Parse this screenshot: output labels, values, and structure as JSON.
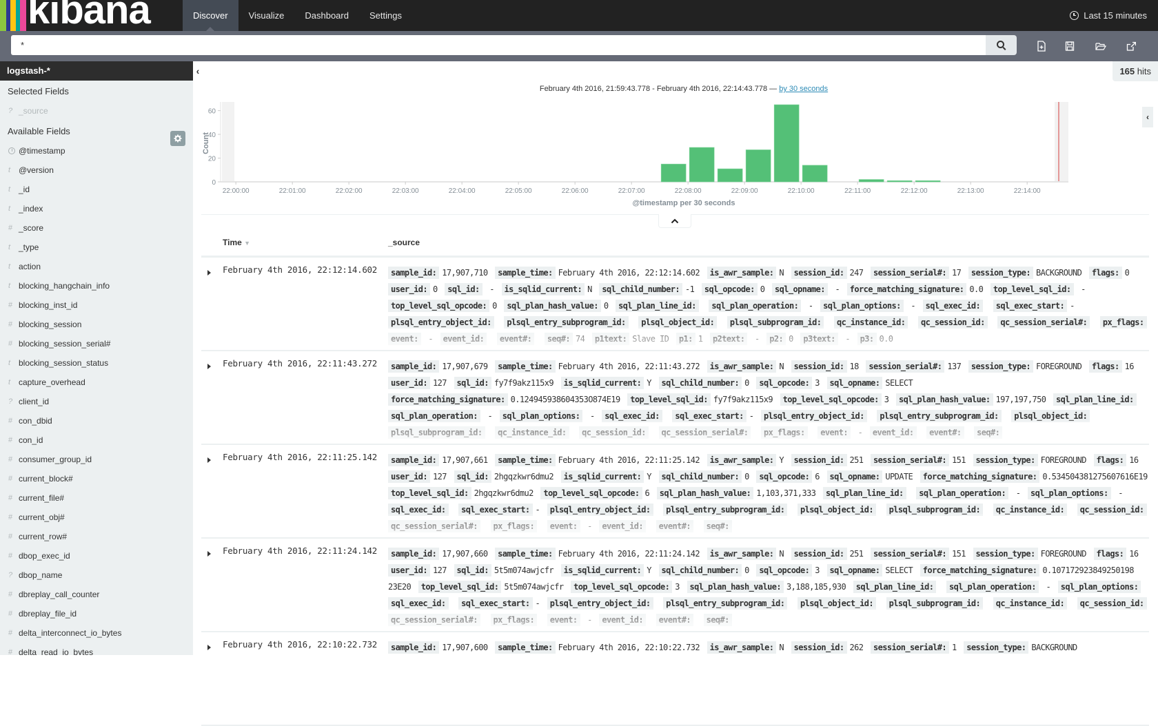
{
  "nav": {
    "brand": "kibana",
    "brand_stripes": [
      "#8cc63f",
      "#2d3991",
      "#fec514",
      "#00a69b",
      "#ec4899"
    ],
    "items": [
      {
        "label": "Discover",
        "active": true
      },
      {
        "label": "Visualize",
        "active": false
      },
      {
        "label": "Dashboard",
        "active": false
      },
      {
        "label": "Settings",
        "active": false
      }
    ],
    "time_range": "Last 15 minutes"
  },
  "search": {
    "query": "*",
    "icons": [
      "search-icon",
      "new-document-icon",
      "save-icon",
      "open-folder-icon",
      "share-icon"
    ]
  },
  "sidebar": {
    "index_pattern": "logstash-*",
    "selected_title": "Selected Fields",
    "selected_fields": [
      {
        "type": "?",
        "name": "_source"
      }
    ],
    "available_title": "Available Fields",
    "available_fields": [
      {
        "type": "clock",
        "name": "@timestamp"
      },
      {
        "type": "t",
        "name": "@version"
      },
      {
        "type": "t",
        "name": "_id"
      },
      {
        "type": "t",
        "name": "_index"
      },
      {
        "type": "#",
        "name": "_score"
      },
      {
        "type": "t",
        "name": "_type"
      },
      {
        "type": "t",
        "name": "action"
      },
      {
        "type": "t",
        "name": "blocking_hangchain_info"
      },
      {
        "type": "#",
        "name": "blocking_inst_id"
      },
      {
        "type": "#",
        "name": "blocking_session"
      },
      {
        "type": "#",
        "name": "blocking_session_serial#"
      },
      {
        "type": "t",
        "name": "blocking_session_status"
      },
      {
        "type": "t",
        "name": "capture_overhead"
      },
      {
        "type": "?",
        "name": "client_id"
      },
      {
        "type": "#",
        "name": "con_dbid"
      },
      {
        "type": "#",
        "name": "con_id"
      },
      {
        "type": "#",
        "name": "consumer_group_id"
      },
      {
        "type": "#",
        "name": "current_block#"
      },
      {
        "type": "#",
        "name": "current_file#"
      },
      {
        "type": "#",
        "name": "current_obj#"
      },
      {
        "type": "#",
        "name": "current_row#"
      },
      {
        "type": "#",
        "name": "dbop_exec_id"
      },
      {
        "type": "?",
        "name": "dbop_name"
      },
      {
        "type": "#",
        "name": "dbreplay_call_counter"
      },
      {
        "type": "#",
        "name": "dbreplay_file_id"
      },
      {
        "type": "#",
        "name": "delta_interconnect_io_bytes"
      },
      {
        "type": "#",
        "name": "delta_read_io_bytes"
      }
    ]
  },
  "hits": {
    "count": "165",
    "label": "hits"
  },
  "chart_caption": {
    "range": "February 4th 2016, 21:59:43.778 - February 4th 2016, 22:14:43.778 —",
    "interval_link": "by 30 seconds"
  },
  "chart_data": {
    "type": "bar",
    "title": "",
    "xlabel": "@timestamp per 30 seconds",
    "ylabel": "Count",
    "ylim": [
      0,
      65
    ],
    "yticks": [
      0,
      20,
      40,
      60
    ],
    "xticks": [
      "22:00:00",
      "22:01:00",
      "22:02:00",
      "22:03:00",
      "22:04:00",
      "22:05:00",
      "22:06:00",
      "22:07:00",
      "22:08:00",
      "22:09:00",
      "22:10:00",
      "22:11:00",
      "22:12:00",
      "22:13:00",
      "22:14:00"
    ],
    "categories": [
      "22:07:30",
      "22:08:00",
      "22:08:30",
      "22:09:00",
      "22:09:30",
      "22:10:00",
      "22:10:30",
      "22:11:00",
      "22:11:30",
      "22:12:00"
    ],
    "values": [
      15,
      29,
      11,
      27,
      65,
      14,
      0,
      2,
      1,
      1
    ],
    "bar_color": "#54c077",
    "now_marker_color": "#e07a7a",
    "grid": false
  },
  "table": {
    "columns": [
      "Time",
      "_source"
    ],
    "rows": [
      {
        "time": "February 4th 2016, 22:12:14.602",
        "fields": [
          [
            "sample_id:",
            "17,907,710"
          ],
          [
            "sample_time:",
            "February 4th 2016, 22:12:14.602"
          ],
          [
            "is_awr_sample:",
            "N"
          ],
          [
            "session_id:",
            "247"
          ],
          [
            "session_serial#:",
            "17"
          ],
          [
            "session_type:",
            "BACKGROUND"
          ],
          [
            "flags:",
            "0"
          ],
          [
            "user_id:",
            "0"
          ],
          [
            "sql_id:",
            " - "
          ],
          [
            "is_sqlid_current:",
            "N"
          ],
          [
            "sql_child_number:",
            "-1"
          ],
          [
            "sql_opcode:",
            "0"
          ],
          [
            "sql_opname:",
            " - "
          ],
          [
            "force_matching_signature:",
            "0.0"
          ],
          [
            "top_level_sql_id:",
            " - "
          ],
          [
            "top_level_sql_opcode:",
            "0"
          ],
          [
            "sql_plan_hash_value:",
            "0"
          ],
          [
            "sql_plan_line_id:",
            ""
          ],
          [
            "sql_plan_operation:",
            " - "
          ],
          [
            "sql_plan_options:",
            " - "
          ],
          [
            "sql_exec_id:",
            ""
          ],
          [
            "sql_exec_start:",
            "-"
          ],
          [
            "plsql_entry_object_id:",
            ""
          ],
          [
            "plsql_entry_subprogram_id:",
            ""
          ],
          [
            "plsql_object_id:",
            ""
          ],
          [
            "plsql_subprogram_id:",
            ""
          ],
          [
            "qc_instance_id:",
            ""
          ],
          [
            "qc_session_id:",
            ""
          ],
          [
            "qc_session_serial#:",
            ""
          ],
          [
            "px_flags:",
            ""
          ],
          [
            "event:",
            " - "
          ],
          [
            "event_id:",
            ""
          ],
          [
            "event#:",
            ""
          ],
          [
            "seq#:",
            "74"
          ],
          [
            "p1text:",
            "Slave ID"
          ],
          [
            "p1:",
            "1"
          ],
          [
            "p2text:",
            " - "
          ],
          [
            "p2:",
            "0"
          ],
          [
            "p3text:",
            " - "
          ],
          [
            "p3:",
            "0.0"
          ]
        ]
      },
      {
        "time": "February 4th 2016, 22:11:43.272",
        "fields": [
          [
            "sample_id:",
            "17,907,679"
          ],
          [
            "sample_time:",
            "February 4th 2016, 22:11:43.272"
          ],
          [
            "is_awr_sample:",
            "N"
          ],
          [
            "session_id:",
            "18"
          ],
          [
            "session_serial#:",
            "137"
          ],
          [
            "session_type:",
            "FOREGROUND"
          ],
          [
            "flags:",
            "16"
          ],
          [
            "user_id:",
            "127"
          ],
          [
            "sql_id:",
            "fy7f9akz115x9"
          ],
          [
            "is_sqlid_current:",
            "Y"
          ],
          [
            "sql_child_number:",
            "0"
          ],
          [
            "sql_opcode:",
            "3"
          ],
          [
            "sql_opname:",
            "SELECT"
          ],
          [
            "force_matching_signature:",
            "0.124945938604353O874E19"
          ],
          [
            "top_level_sql_id:",
            "fy7f9akz115x9"
          ],
          [
            "top_level_sql_opcode:",
            "3"
          ],
          [
            "sql_plan_hash_value:",
            "197,197,750"
          ],
          [
            "sql_plan_line_id:",
            ""
          ],
          [
            "sql_plan_operation:",
            " - "
          ],
          [
            "sql_plan_options:",
            " - "
          ],
          [
            "sql_exec_id:",
            ""
          ],
          [
            "sql_exec_start:",
            "-"
          ],
          [
            "plsql_entry_object_id:",
            ""
          ],
          [
            "plsql_entry_subprogram_id:",
            ""
          ],
          [
            "plsql_object_id:",
            ""
          ],
          [
            "plsql_subprogram_id:",
            ""
          ],
          [
            "qc_instance_id:",
            ""
          ],
          [
            "qc_session_id:",
            ""
          ],
          [
            "qc_session_serial#:",
            ""
          ],
          [
            "px_flags:",
            ""
          ],
          [
            "event:",
            " - "
          ],
          [
            "event_id:",
            ""
          ],
          [
            "event#:",
            ""
          ],
          [
            "seq#:",
            ""
          ]
        ]
      },
      {
        "time": "February 4th 2016, 22:11:25.142",
        "fields": [
          [
            "sample_id:",
            "17,907,661"
          ],
          [
            "sample_time:",
            "February 4th 2016, 22:11:25.142"
          ],
          [
            "is_awr_sample:",
            "Y"
          ],
          [
            "session_id:",
            "251"
          ],
          [
            "session_serial#:",
            "151"
          ],
          [
            "session_type:",
            "FOREGROUND"
          ],
          [
            "flags:",
            "16"
          ],
          [
            "user_id:",
            "127"
          ],
          [
            "sql_id:",
            "2hgqzkwr6dmu2"
          ],
          [
            "is_sqlid_current:",
            "Y"
          ],
          [
            "sql_child_number:",
            "0"
          ],
          [
            "sql_opcode:",
            "6"
          ],
          [
            "sql_opname:",
            "UPDATE"
          ],
          [
            "force_matching_signature:",
            "0.534504381275607616E19"
          ],
          [
            "top_level_sql_id:",
            "2hgqzkwr6dmu2"
          ],
          [
            "top_level_sql_opcode:",
            "6"
          ],
          [
            "sql_plan_hash_value:",
            "1,103,371,333"
          ],
          [
            "sql_plan_line_id:",
            ""
          ],
          [
            "sql_plan_operation:",
            " - "
          ],
          [
            "sql_plan_options:",
            " - "
          ],
          [
            "sql_exec_id:",
            ""
          ],
          [
            "sql_exec_start:",
            "-"
          ],
          [
            "plsql_entry_object_id:",
            ""
          ],
          [
            "plsql_entry_subprogram_id:",
            ""
          ],
          [
            "plsql_object_id:",
            ""
          ],
          [
            "plsql_subprogram_id:",
            ""
          ],
          [
            "qc_instance_id:",
            ""
          ],
          [
            "qc_session_id:",
            ""
          ],
          [
            "qc_session_serial#:",
            ""
          ],
          [
            "px_flags:",
            ""
          ],
          [
            "event:",
            " - "
          ],
          [
            "event_id:",
            ""
          ],
          [
            "event#:",
            ""
          ],
          [
            "seq#:",
            ""
          ]
        ]
      },
      {
        "time": "February 4th 2016, 22:11:24.142",
        "fields": [
          [
            "sample_id:",
            "17,907,660"
          ],
          [
            "sample_time:",
            "February 4th 2016, 22:11:24.142"
          ],
          [
            "is_awr_sample:",
            "N"
          ],
          [
            "session_id:",
            "251"
          ],
          [
            "session_serial#:",
            "151"
          ],
          [
            "session_type:",
            "FOREGROUND"
          ],
          [
            "flags:",
            "16"
          ],
          [
            "user_id:",
            "127"
          ],
          [
            "sql_id:",
            "5t5m074awjcfr"
          ],
          [
            "is_sqlid_current:",
            "Y"
          ],
          [
            "sql_child_number:",
            "0"
          ],
          [
            "sql_opcode:",
            "3"
          ],
          [
            "sql_opname:",
            "SELECT"
          ],
          [
            "force_matching_signature:",
            "0.107172923849250198 23E20"
          ],
          [
            "top_level_sql_id:",
            "5t5m074awjcfr"
          ],
          [
            "top_level_sql_opcode:",
            "3"
          ],
          [
            "sql_plan_hash_value:",
            "3,188,185,930"
          ],
          [
            "sql_plan_line_id:",
            ""
          ],
          [
            "sql_plan_operation:",
            " - "
          ],
          [
            "sql_plan_options:",
            " - "
          ],
          [
            "sql_exec_id:",
            ""
          ],
          [
            "sql_exec_start:",
            "-"
          ],
          [
            "plsql_entry_object_id:",
            ""
          ],
          [
            "plsql_entry_subprogram_id:",
            ""
          ],
          [
            "plsql_object_id:",
            ""
          ],
          [
            "plsql_subprogram_id:",
            ""
          ],
          [
            "qc_instance_id:",
            ""
          ],
          [
            "qc_session_id:",
            ""
          ],
          [
            "qc_session_serial#:",
            ""
          ],
          [
            "px_flags:",
            ""
          ],
          [
            "event:",
            " - "
          ],
          [
            "event_id:",
            ""
          ],
          [
            "event#:",
            ""
          ],
          [
            "seq#:",
            ""
          ]
        ]
      },
      {
        "time": "February 4th 2016, 22:10:22.732",
        "fields": [
          [
            "sample_id:",
            "17,907,600"
          ],
          [
            "sample_time:",
            "February 4th 2016, 22:10:22.732"
          ],
          [
            "is_awr_sample:",
            "N"
          ],
          [
            "session_id:",
            "262"
          ],
          [
            "session_serial#:",
            "1"
          ],
          [
            "session_type:",
            "BACKGROUND"
          ]
        ]
      }
    ]
  }
}
